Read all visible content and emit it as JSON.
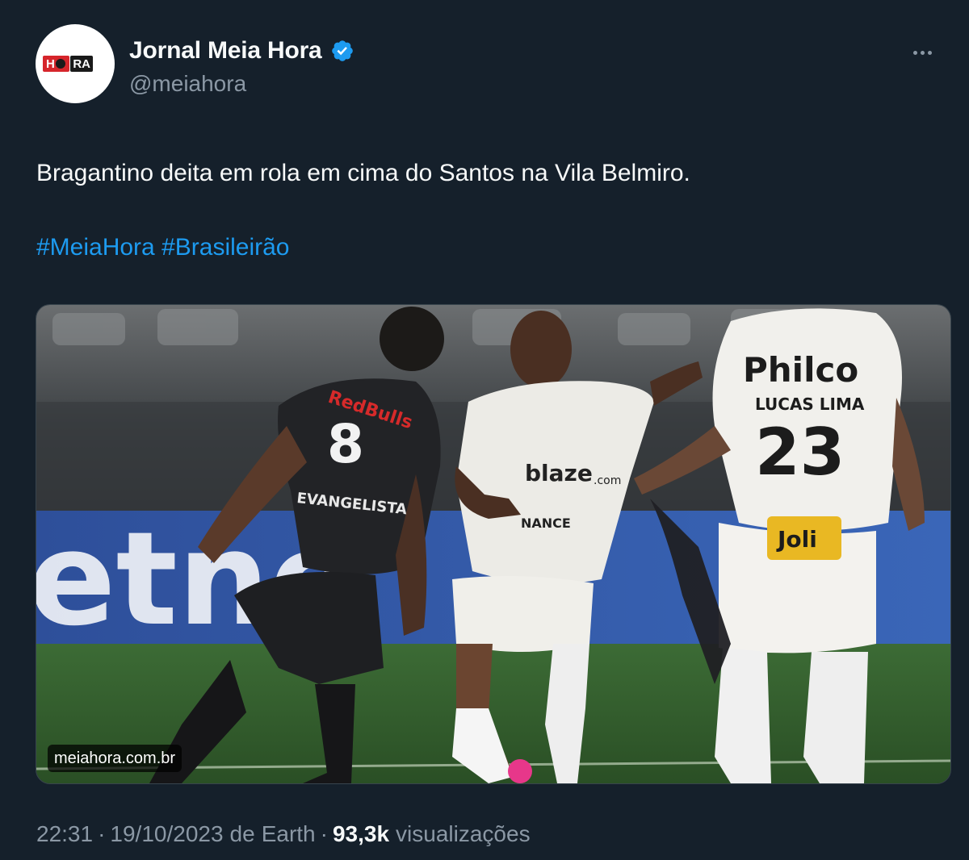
{
  "author": {
    "display_name": "Jornal Meia Hora",
    "handle": "@meiahora",
    "verified": true,
    "avatar_icon": "meia-hora-logo",
    "logo_text_left": "H",
    "logo_text_right": "RA"
  },
  "tweet": {
    "text": "Bragantino deita em rola em cima do Santos na Vila Belmiro.",
    "hashtags": [
      "#MeiaHora",
      "#Brasileirão"
    ]
  },
  "media": {
    "source_label": "meiahora.com.br",
    "jersey_left_number": "8",
    "jersey_left_sponsor": "RedBulls",
    "jersey_left_name": "EVANGELISTA",
    "jersey_right_number": "23",
    "jersey_right_sponsor": "Philco",
    "jersey_right_name": "LUCAS LIMA",
    "jersey_right_badge": "Joli",
    "jersey_center_sponsor": "blaze",
    "jersey_center_sponsor_sub": ".com",
    "jersey_center_bottom": "NANCE",
    "board_text": "etno"
  },
  "meta": {
    "time": "22:31",
    "separator": "·",
    "date": "19/10/2023",
    "source_prefix": "de",
    "source": "Earth",
    "views_count": "93,3k",
    "views_label": "visualizações"
  },
  "colors": {
    "background": "#15202b",
    "text_primary": "#f7f9f9",
    "text_secondary": "#8b98a5",
    "link": "#1d9bf0",
    "verified": "#1d9bf0",
    "brand_red": "#d6252b"
  }
}
